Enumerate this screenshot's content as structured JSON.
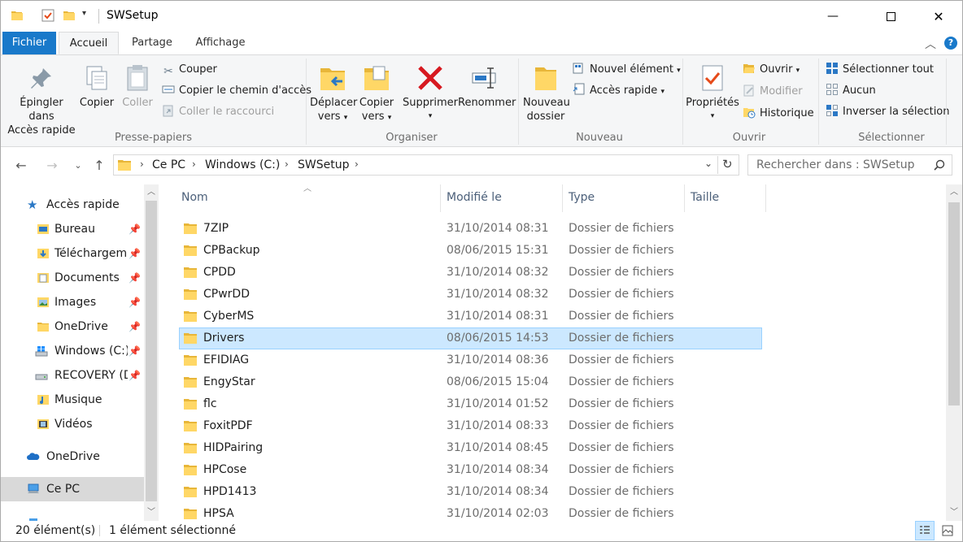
{
  "window": {
    "title": "SWSetup"
  },
  "tabs": {
    "file": "Fichier",
    "home": "Accueil",
    "share": "Partage",
    "view": "Affichage"
  },
  "ribbon": {
    "clipboard": {
      "pin": "Épingler dans\nAccès rapide",
      "pin_l1": "Épingler dans",
      "pin_l2": "Accès rapide",
      "copy": "Copier",
      "paste": "Coller",
      "cut": "Couper",
      "copy_path": "Copier le chemin d'accès",
      "paste_shortcut": "Coller le raccourci",
      "label": "Presse-papiers"
    },
    "organize": {
      "move_l1": "Déplacer",
      "move_l2": "vers",
      "copy_l1": "Copier",
      "copy_l2": "vers",
      "delete": "Supprimer",
      "rename": "Renommer",
      "label": "Organiser"
    },
    "new": {
      "folder_l1": "Nouveau",
      "folder_l2": "dossier",
      "new_item": "Nouvel élément",
      "easy_access": "Accès rapide",
      "label": "Nouveau"
    },
    "open": {
      "properties": "Propriétés",
      "open": "Ouvrir",
      "edit": "Modifier",
      "history": "Historique",
      "label": "Ouvrir"
    },
    "select": {
      "select_all": "Sélectionner tout",
      "select_none": "Aucun",
      "invert": "Inverser la sélection",
      "label": "Sélectionner"
    }
  },
  "address": {
    "crumbs": [
      "Ce PC",
      "Windows (C:)",
      "SWSetup"
    ],
    "search_placeholder": "Rechercher dans : SWSetup"
  },
  "nav": {
    "items": [
      {
        "label": "Accès rapide",
        "icon": "star-icon",
        "pinned": false
      },
      {
        "label": "Bureau",
        "icon": "desktop-folder-icon",
        "pinned": true
      },
      {
        "label": "Téléchargements",
        "icon": "downloads-folder-icon",
        "pinned": true
      },
      {
        "label": "Documents",
        "icon": "documents-folder-icon",
        "pinned": true
      },
      {
        "label": "Images",
        "icon": "pictures-folder-icon",
        "pinned": true
      },
      {
        "label": "OneDrive",
        "icon": "folder-icon",
        "pinned": true
      },
      {
        "label": "Windows (C:)",
        "icon": "drive-icon",
        "pinned": true
      },
      {
        "label": "RECOVERY (D:)",
        "icon": "drive-icon",
        "pinned": true
      },
      {
        "label": "Musique",
        "icon": "music-folder-icon",
        "pinned": false
      },
      {
        "label": "Vidéos",
        "icon": "videos-folder-icon",
        "pinned": false
      },
      {
        "label": "OneDrive",
        "icon": "cloud-icon",
        "pinned": false
      },
      {
        "label": "Ce PC",
        "icon": "computer-icon",
        "pinned": false
      }
    ]
  },
  "columns": {
    "name": "Nom",
    "modified": "Modifié le",
    "type": "Type",
    "size": "Taille"
  },
  "files": [
    {
      "name": "7ZIP",
      "date": "31/10/2014 08:31",
      "type": "Dossier de fichiers"
    },
    {
      "name": "CPBackup",
      "date": "08/06/2015 15:31",
      "type": "Dossier de fichiers"
    },
    {
      "name": "CPDD",
      "date": "31/10/2014 08:32",
      "type": "Dossier de fichiers"
    },
    {
      "name": "CPwrDD",
      "date": "31/10/2014 08:32",
      "type": "Dossier de fichiers"
    },
    {
      "name": "CyberMS",
      "date": "31/10/2014 08:31",
      "type": "Dossier de fichiers"
    },
    {
      "name": "Drivers",
      "date": "08/06/2015 14:53",
      "type": "Dossier de fichiers",
      "selected": true
    },
    {
      "name": "EFIDIAG",
      "date": "31/10/2014 08:36",
      "type": "Dossier de fichiers"
    },
    {
      "name": "EngyStar",
      "date": "08/06/2015 15:04",
      "type": "Dossier de fichiers"
    },
    {
      "name": "flc",
      "date": "31/10/2014 01:52",
      "type": "Dossier de fichiers"
    },
    {
      "name": "FoxitPDF",
      "date": "31/10/2014 08:33",
      "type": "Dossier de fichiers"
    },
    {
      "name": "HIDPairing",
      "date": "31/10/2014 08:45",
      "type": "Dossier de fichiers"
    },
    {
      "name": "HPCose",
      "date": "31/10/2014 08:34",
      "type": "Dossier de fichiers"
    },
    {
      "name": "HPD1413",
      "date": "31/10/2014 08:34",
      "type": "Dossier de fichiers"
    },
    {
      "name": "HPSA",
      "date": "31/10/2014 02:03",
      "type": "Dossier de fichiers"
    }
  ],
  "status": {
    "count": "20 élément(s)",
    "selected": "1 élément sélectionné"
  },
  "colors": {
    "file_tab": "#1979ca",
    "selection": "#cce8ff",
    "folder": "#ffd766"
  }
}
